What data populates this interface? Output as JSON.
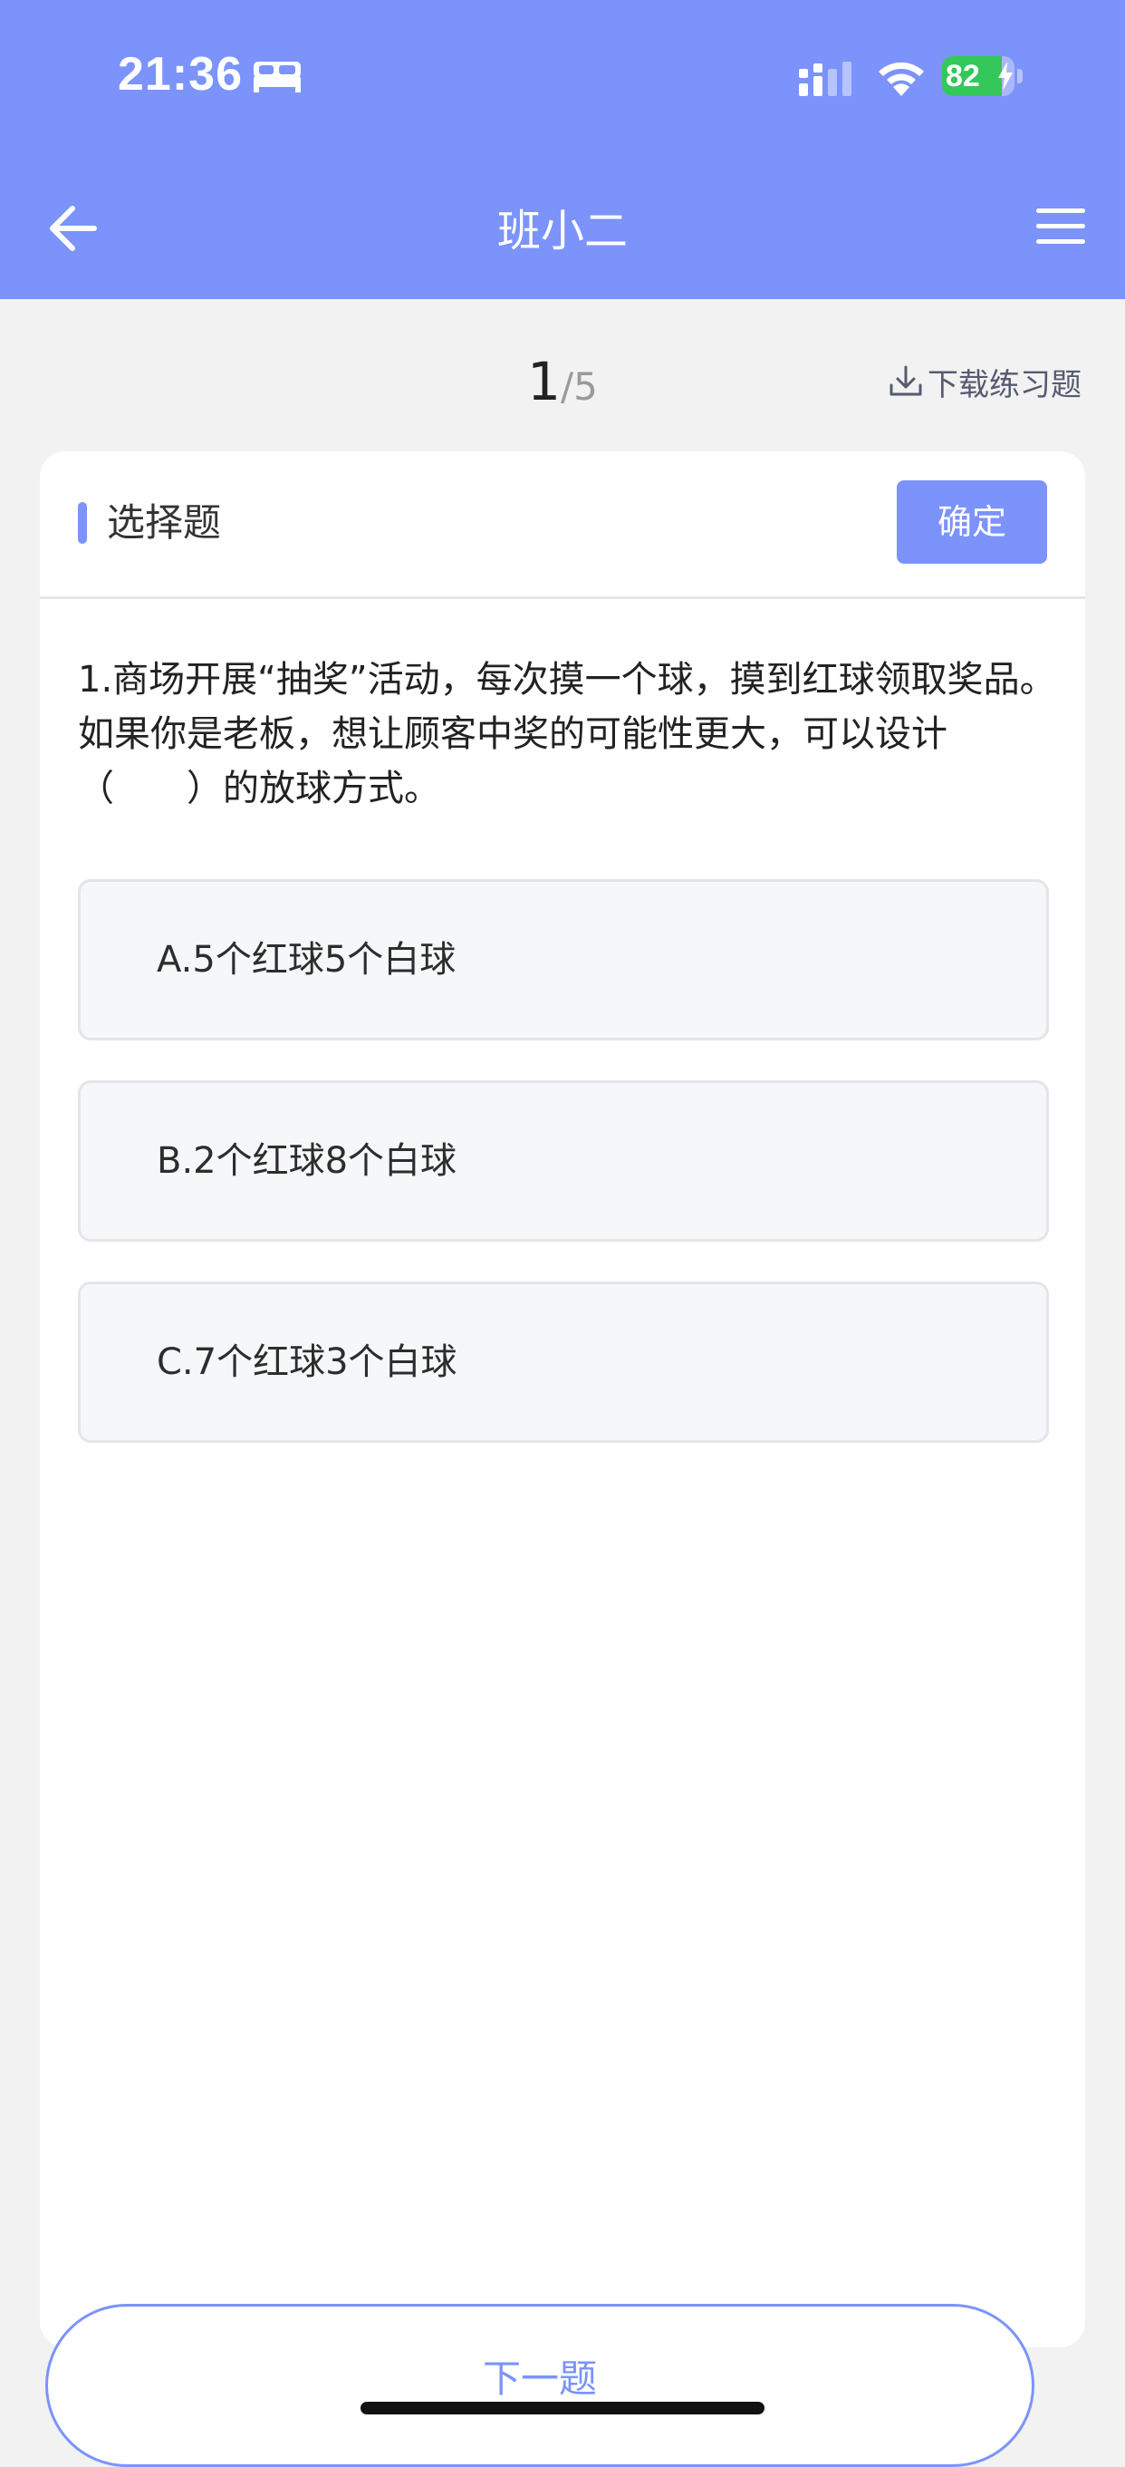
{
  "status_bar": {
    "time": "21:36",
    "battery_level": "82",
    "icons": [
      "sleep-bed-icon",
      "cellular-signal-icon",
      "wifi-icon",
      "battery-charging-icon"
    ]
  },
  "nav": {
    "title": "班小二",
    "back_icon": "arrow-left-icon",
    "menu_icon": "hamburger-menu-icon"
  },
  "progress": {
    "current": "1",
    "total": "/5"
  },
  "download": {
    "label": "下载练习题",
    "icon": "download-icon"
  },
  "card": {
    "type_label": "选择题",
    "confirm_label": "确定",
    "question": "1.商场开展“抽奖”活动，每次摸一个球，摸到红球领取奖品。如果你是老板，想让顾客中奖的可能性更大，可以设计（　　）的放球方式。",
    "options": [
      {
        "label": "A.5个红球5个白球"
      },
      {
        "label": "B.2个红球8个白球"
      },
      {
        "label": "C.7个红球3个白球"
      }
    ]
  },
  "footer": {
    "next_label": "下一题"
  },
  "colors": {
    "primary": "#7b93fb",
    "background": "#f2f2f2",
    "card": "#ffffff",
    "option_bg": "#f6f7f9",
    "battery_green": "#34c759"
  }
}
